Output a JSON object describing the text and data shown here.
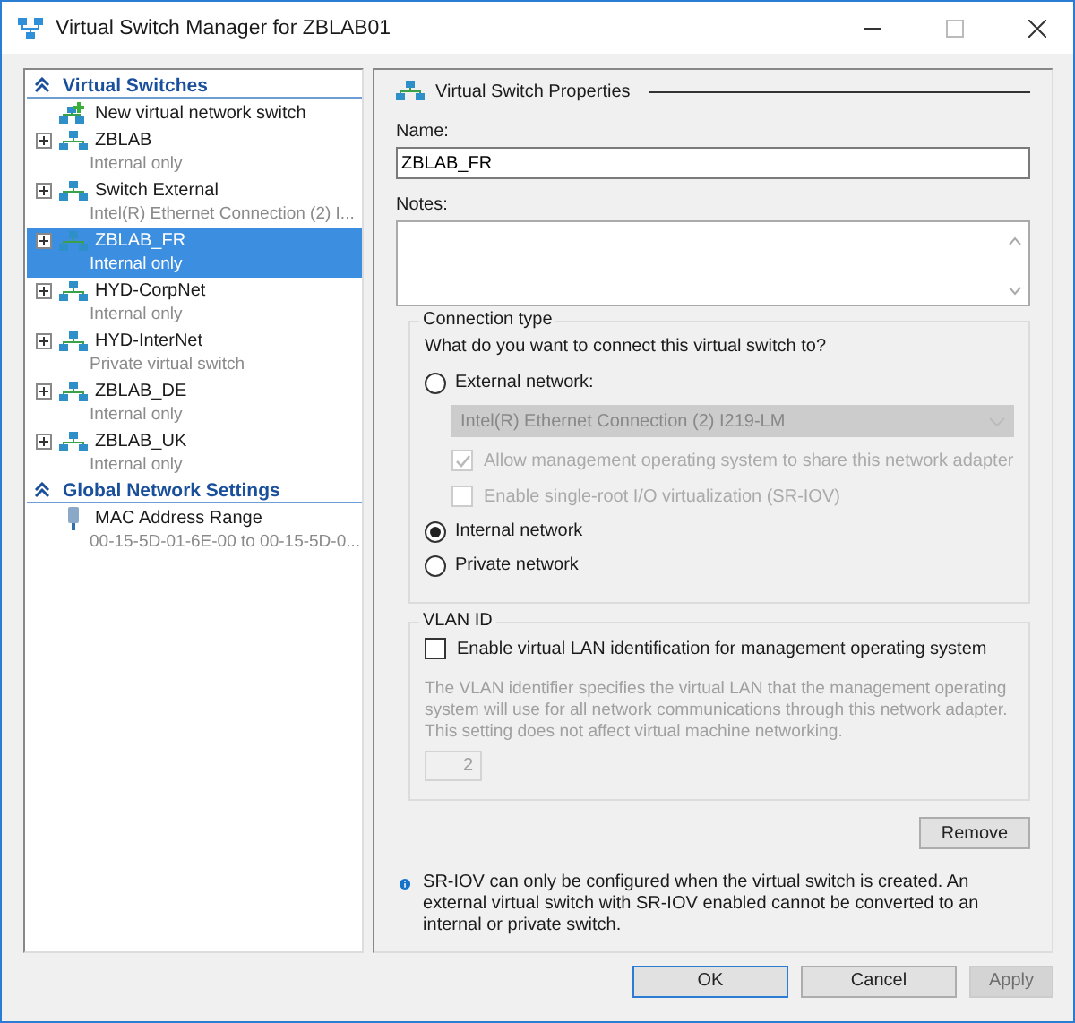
{
  "window": {
    "title": "Virtual Switch Manager for ZBLAB01"
  },
  "sidebar": {
    "sections": [
      {
        "title": "Virtual Switches",
        "expanded": true,
        "items": [
          {
            "kind": "new",
            "label": "New virtual network switch",
            "selected": false
          },
          {
            "kind": "switch",
            "label": "ZBLAB",
            "detail": "Internal only",
            "selected": false
          },
          {
            "kind": "switch",
            "label": "Switch External",
            "detail": "Intel(R) Ethernet Connection (2) I...",
            "selected": false
          },
          {
            "kind": "switch",
            "label": "ZBLAB_FR",
            "detail": "Internal only",
            "selected": true
          },
          {
            "kind": "switch",
            "label": "HYD-CorpNet",
            "detail": "Internal only",
            "selected": false
          },
          {
            "kind": "switch",
            "label": "HYD-InterNet",
            "detail": "Private virtual switch",
            "selected": false
          },
          {
            "kind": "switch",
            "label": "ZBLAB_DE",
            "detail": "Internal only",
            "selected": false
          },
          {
            "kind": "switch",
            "label": "ZBLAB_UK",
            "detail": "Internal only",
            "selected": false
          }
        ]
      },
      {
        "title": "Global Network Settings",
        "expanded": true,
        "items": [
          {
            "kind": "mac",
            "label": "MAC Address Range",
            "detail": "00-15-5D-01-6E-00 to 00-15-5D-0...",
            "selected": false
          }
        ]
      }
    ]
  },
  "properties": {
    "header": "Virtual Switch Properties",
    "name_label": "Name:",
    "name_value": "ZBLAB_FR",
    "notes_label": "Notes:",
    "connection": {
      "legend": "Connection type",
      "question": "What do you want to connect this virtual switch to?",
      "options": [
        {
          "label": "External network:",
          "selected": false,
          "adapter": "Intel(R) Ethernet Connection (2) I219-LM",
          "checkboxes": [
            {
              "label": "Allow management operating system to share this network adapter",
              "checked": true,
              "disabled": true
            },
            {
              "label": "Enable single-root I/O virtualization (SR-IOV)",
              "checked": false,
              "disabled": true
            }
          ]
        },
        {
          "label": "Internal network",
          "selected": true
        },
        {
          "label": "Private network",
          "selected": false
        }
      ]
    },
    "vlan": {
      "legend": "VLAN ID",
      "checkbox": {
        "label": "Enable virtual LAN identification for management operating system",
        "checked": false
      },
      "description": "The VLAN identifier specifies the virtual LAN that the management operating system will use for all network communications through this network adapter. This setting does not affect virtual machine networking.",
      "value": "2",
      "disabled": true
    },
    "remove_button": "Remove",
    "info": "SR-IOV can only be configured when the virtual switch is created. An external virtual switch with SR-IOV enabled cannot be converted to an internal or private switch."
  },
  "buttons": [
    {
      "label": "OK",
      "kind": "default"
    },
    {
      "label": "Cancel",
      "kind": "normal"
    },
    {
      "label": "Apply",
      "kind": "disabled"
    }
  ]
}
